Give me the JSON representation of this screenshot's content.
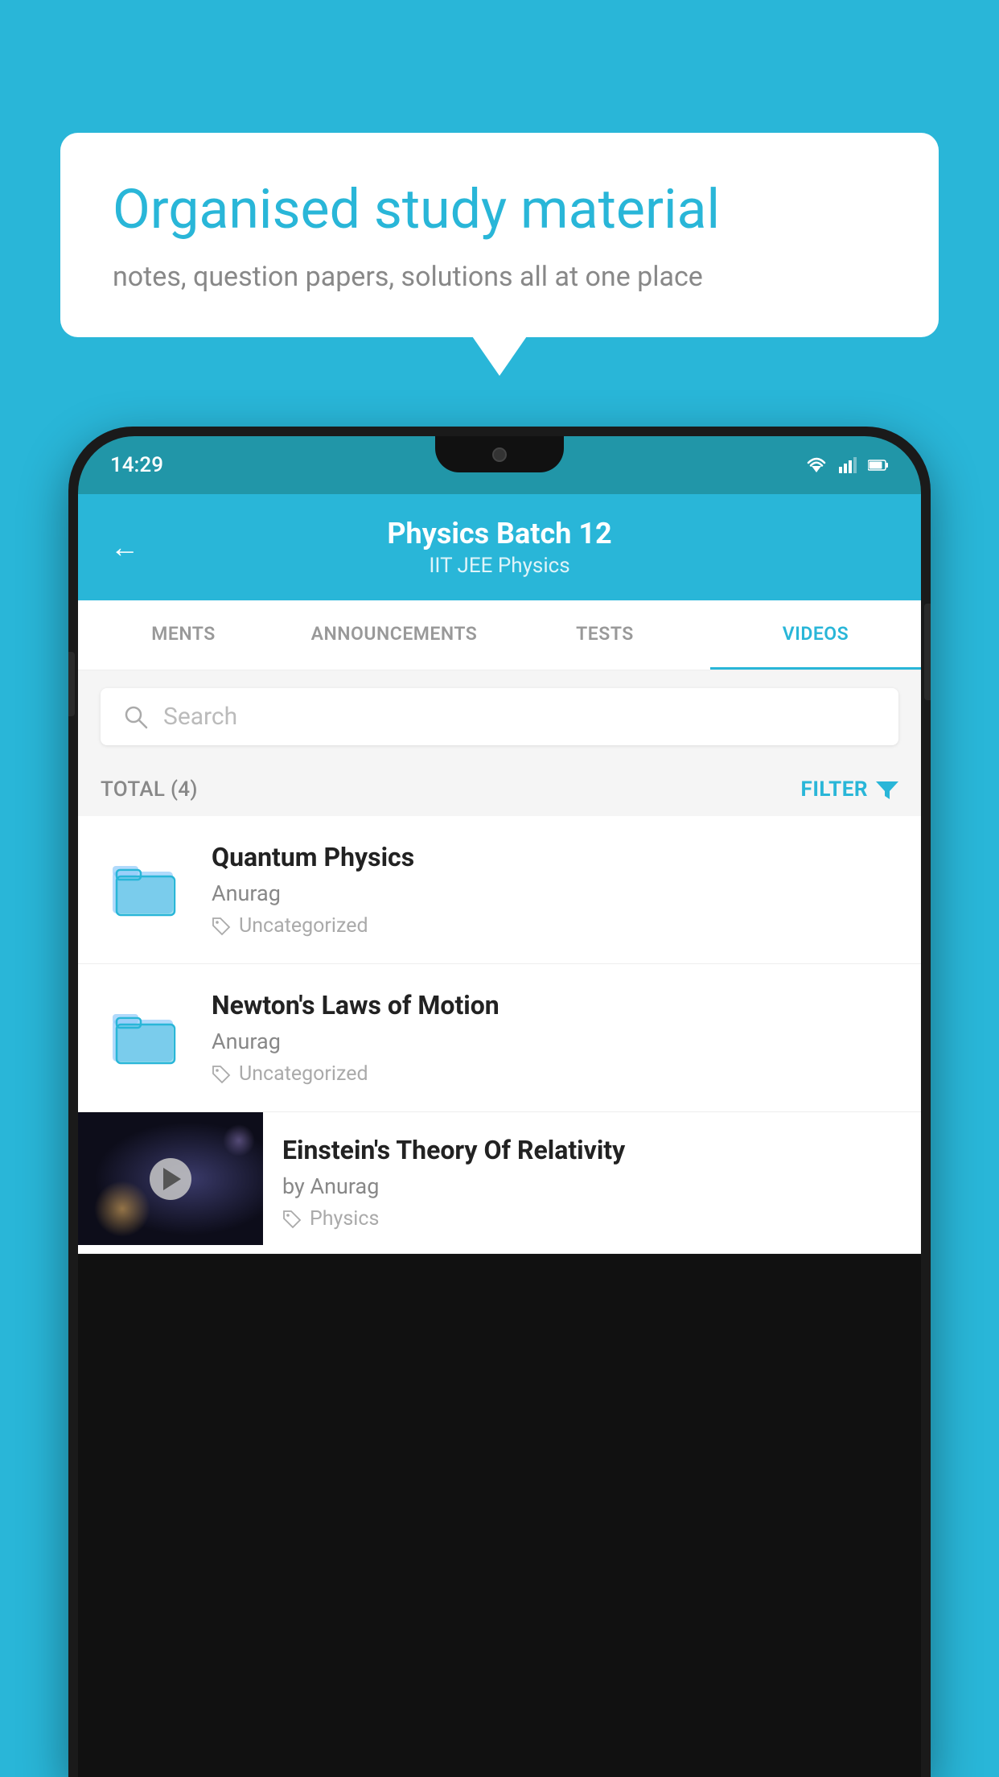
{
  "background_color": "#29b6d8",
  "speech_bubble": {
    "title": "Organised study material",
    "subtitle": "notes, question papers, solutions all at one place"
  },
  "phone": {
    "status_bar": {
      "time": "14:29",
      "icons": [
        "wifi",
        "signal",
        "battery"
      ]
    },
    "app_header": {
      "back_label": "←",
      "title": "Physics Batch 12",
      "subtitle": "IIT JEE   Physics"
    },
    "tabs": [
      {
        "label": "MENTS",
        "active": false
      },
      {
        "label": "ANNOUNCEMENTS",
        "active": false
      },
      {
        "label": "TESTS",
        "active": false
      },
      {
        "label": "VIDEOS",
        "active": true
      }
    ],
    "search": {
      "placeholder": "Search"
    },
    "filter_row": {
      "total_label": "TOTAL (4)",
      "filter_label": "FILTER"
    },
    "videos": [
      {
        "type": "folder",
        "title": "Quantum Physics",
        "author": "Anurag",
        "tag": "Uncategorized"
      },
      {
        "type": "folder",
        "title": "Newton's Laws of Motion",
        "author": "Anurag",
        "tag": "Uncategorized"
      },
      {
        "type": "thumbnail",
        "title": "Einstein's Theory Of Relativity",
        "author": "by Anurag",
        "tag": "Physics"
      }
    ]
  }
}
